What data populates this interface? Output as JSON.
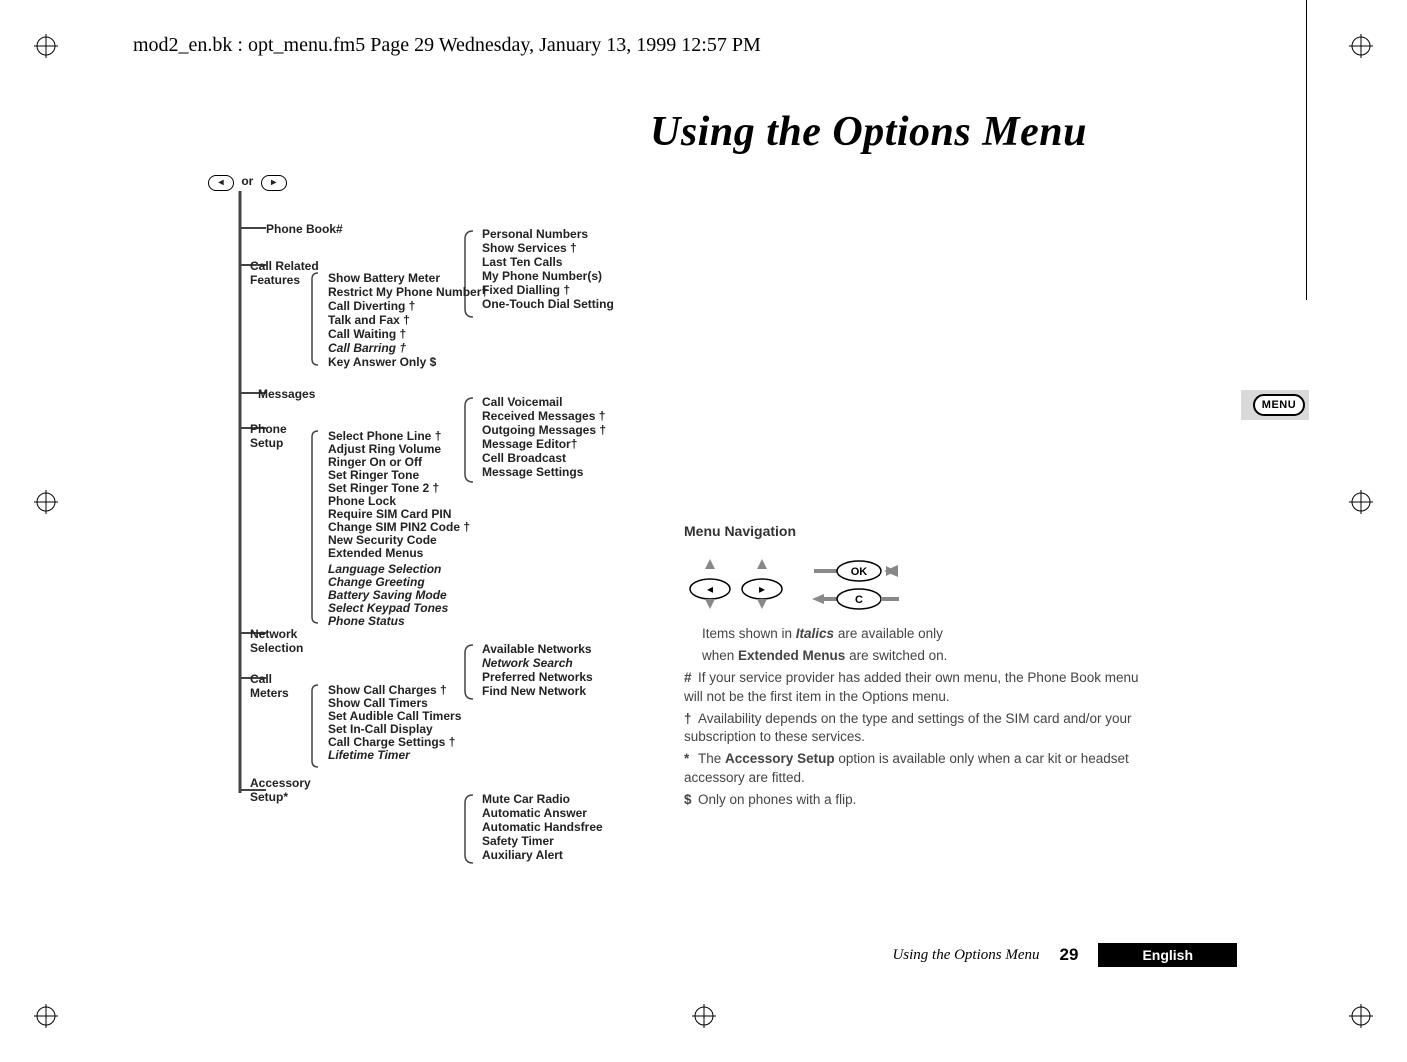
{
  "header": "mod2_en.bk : opt_menu.fm5  Page 29  Wednesday, January 13, 1999  12:57 PM",
  "title": "Using the Options Menu",
  "side_tab": "MENU",
  "root_or": "or",
  "tree": {
    "phone_book": "Phone Book#",
    "phone_book_sub": {
      "a": "Personal Numbers",
      "b": "Show Services †",
      "c": "Last Ten Calls",
      "d": "My Phone Number(s)",
      "e": "Fixed Dialling †",
      "f": "One-Touch Dial Setting"
    },
    "call_related": "Call Related",
    "features": "Features",
    "crf_sub": {
      "a": "Show Battery Meter",
      "b": "Restrict My Phone Number†",
      "c": "Call Diverting †",
      "d": "Talk and Fax †",
      "e": "Call Waiting †",
      "f": "Call Barring †",
      "g": "Key Answer Only $"
    },
    "messages": "Messages",
    "msg_sub": {
      "a": "Call Voicemail",
      "b": "Received Messages †",
      "c": "Outgoing Messages †",
      "d": "Message Editor†",
      "e": "Cell Broadcast",
      "f": "Message Settings"
    },
    "phone_setup": "Phone",
    "phone_setup2": "Setup",
    "ps_sub": {
      "a": "Select Phone Line †",
      "b": "Adjust Ring Volume",
      "c": "Ringer On or Off",
      "d": "Set Ringer Tone",
      "e": "Set Ringer Tone 2 †",
      "f": "Phone Lock",
      "g": "Require SIM Card PIN",
      "h": "Change SIM PIN2 Code †",
      "i": "New Security Code",
      "j": "Extended Menus",
      "k": "Language Selection",
      "l": "Change Greeting",
      "m": "Battery Saving Mode",
      "n": "Select Keypad Tones",
      "o": "Phone Status"
    },
    "network": "Network",
    "network2": "Selection",
    "net_sub": {
      "a": "Available Networks",
      "b": "Network Search",
      "c": "Preferred Networks",
      "d": "Find New Network"
    },
    "call_meters": "Call",
    "call_meters2": "Meters",
    "cm_sub": {
      "a": "Show Call Charges †",
      "b": "Show Call Timers",
      "c": "Set Audible Call Timers",
      "d": "Set In-Call Display",
      "e": "Call Charge Settings †",
      "f": "Lifetime Timer"
    },
    "accessory": "Accessory",
    "accessory2": "Setup*",
    "acc_sub": {
      "a": "Mute Car Radio",
      "b": "Automatic Answer",
      "c": "Automatic Handsfree",
      "d": "Safety Timer",
      "e": "Auxiliary Alert"
    }
  },
  "nav": {
    "heading": "Menu Navigation",
    "keys": {
      "ok": "OK",
      "c": "C",
      "left": "◂",
      "right": "▸"
    },
    "intro1": "Items shown in ",
    "intro1b": "Italics",
    "intro1c": " are available only",
    "intro2a": "when ",
    "intro2b": "Extended Menus",
    "intro2c": " are switched on.",
    "hash": "If your service provider has added their own menu, the Phone Book menu will not be the first item in the Options menu.",
    "dag": "Availability depends on the type and settings of the SIM card and/or your subscription to these services.",
    "star_a": "The ",
    "star_b": "Accessory Setup",
    "star_c": " option is available only when a car kit or headset accessory are fitted.",
    "dollar": "Only on phones with a flip."
  },
  "footer": {
    "title": "Using the Options Menu",
    "page": "29",
    "lang": "English"
  }
}
